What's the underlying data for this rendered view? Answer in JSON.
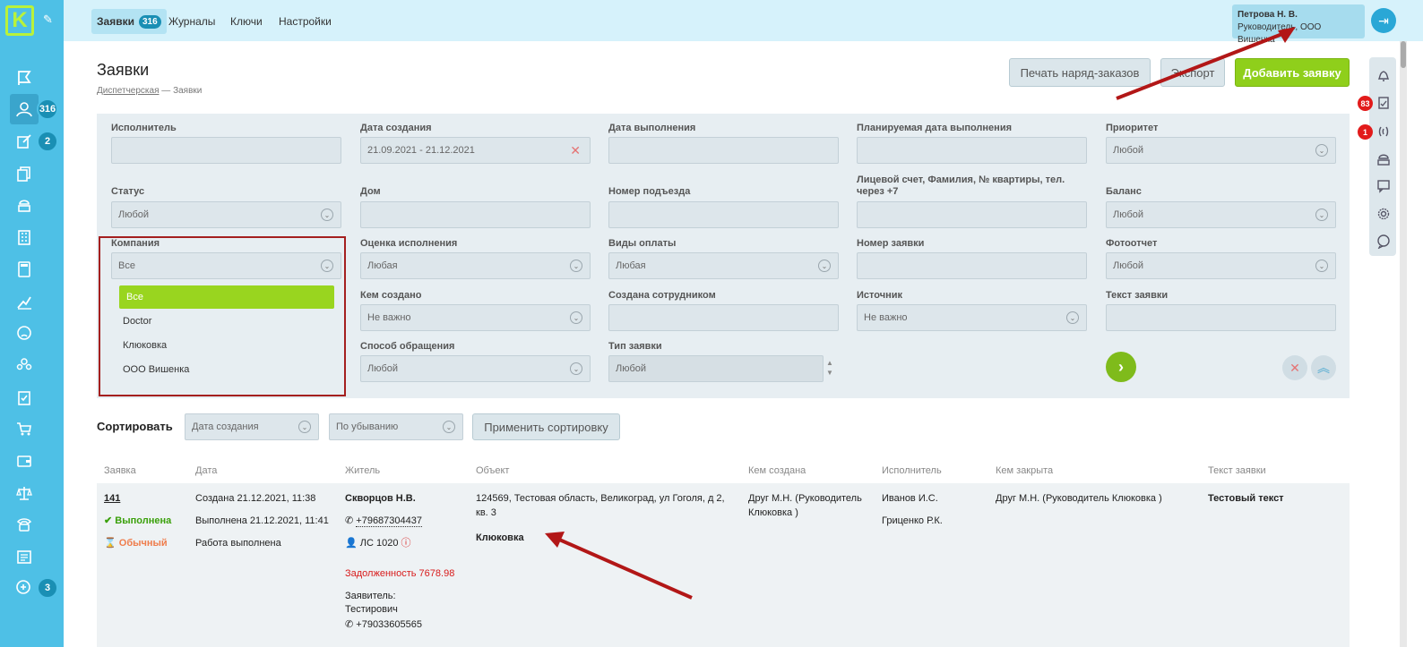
{
  "logo": "K",
  "sidebar_badges": {
    "requests": "316",
    "edit": "2",
    "chat": "3"
  },
  "top_tabs": [
    {
      "label": "Заявки",
      "badge": "316"
    },
    {
      "label": "Журналы"
    },
    {
      "label": "Ключи"
    },
    {
      "label": "Настройки"
    }
  ],
  "user": {
    "name": "Петрова Н. В.",
    "role": "Руководитель, ООО Вишенка"
  },
  "page_title": "Заявки",
  "breadcrumb": {
    "link": "Диспетчерская",
    "sep": " — ",
    "current": "Заявки"
  },
  "buttons": {
    "print": "Печать наряд-заказов",
    "export": "Экспорт",
    "add": "Добавить заявку",
    "apply_sort": "Применить сортировку"
  },
  "right_badges": {
    "tasks": "83",
    "calls": "1"
  },
  "filters": {
    "executor": {
      "label": "Исполнитель",
      "value": ""
    },
    "created": {
      "label": "Дата создания",
      "value": "21.09.2021 - 21.12.2021"
    },
    "done_date": {
      "label": "Дата выполнения",
      "value": ""
    },
    "planned": {
      "label": "Планируемая дата выполнения",
      "value": ""
    },
    "priority": {
      "label": "Приоритет",
      "value": "Любой"
    },
    "status": {
      "label": "Статус",
      "value": "Любой"
    },
    "house": {
      "label": "Дом",
      "value": ""
    },
    "entrance": {
      "label": "Номер подъезда",
      "value": ""
    },
    "account": {
      "label": "Лицевой счет, Фамилия, № квартиры, тел. через +7",
      "value": ""
    },
    "balance": {
      "label": "Баланс",
      "value": "Любой"
    },
    "company": {
      "label": "Компания",
      "value": "Все",
      "options": [
        "Все",
        "Doctor",
        "Клюковка",
        "ООО Вишенка"
      ]
    },
    "rating": {
      "label": "Оценка исполнения",
      "value": "Любая"
    },
    "payment": {
      "label": "Виды оплаты",
      "value": "Любая"
    },
    "req_number": {
      "label": "Номер заявки",
      "value": ""
    },
    "photo": {
      "label": "Фотоотчет",
      "value": "Любой"
    },
    "created_by": {
      "label": "Кем создано",
      "value": "Не важно"
    },
    "created_employee": {
      "label": "Создана сотрудником",
      "value": ""
    },
    "source": {
      "label": "Источник",
      "value": "Не важно"
    },
    "req_text": {
      "label": "Текст заявки",
      "value": ""
    },
    "method": {
      "label": "Способ обращения",
      "value": "Любой"
    },
    "type": {
      "label": "Тип заявки",
      "value": "Любой"
    }
  },
  "sort": {
    "label": "Сортировать",
    "field": "Дата создания",
    "order": "По убыванию"
  },
  "table": {
    "headers": [
      "Заявка",
      "Дата",
      "Житель",
      "Объект",
      "Кем создана",
      "Исполнитель",
      "Кем закрыта",
      "Текст заявки"
    ],
    "row": {
      "id": "141",
      "status": "Выполнена",
      "priority": "Обычный",
      "created": "Создана 21.12.2021, 11:38",
      "done": "Выполнена 21.12.2021, 11:41",
      "result": "Работа выполнена",
      "resident": "Скворцов Н.В.",
      "phone": "+79687304437",
      "account": "ЛС 1020",
      "debt": "Задолженность 7678.98",
      "applicant_label": "Заявитель:",
      "applicant": "Тестирович",
      "applicant_phone": "+79033605565",
      "address": "124569, Тестовая область, Великоград, ул Гоголя, д 2, кв. 3",
      "company": "Клюковка",
      "creator": "Друг М.Н. (Руководитель Клюковка )",
      "executor1": "Иванов И.С.",
      "executor2": "Гриценко Р.К.",
      "closed_by": "Друг М.Н. (Руководитель Клюковка )",
      "text": "Тестовый текст"
    }
  },
  "colors": {
    "sidebar": "#4ec0e6",
    "accent_green": "#8fcf1b",
    "annotation_red": "#a41f1f",
    "debt_red": "#d81b1b",
    "done_green": "#3aa00a",
    "priority_orange": "#ef7d4c"
  }
}
